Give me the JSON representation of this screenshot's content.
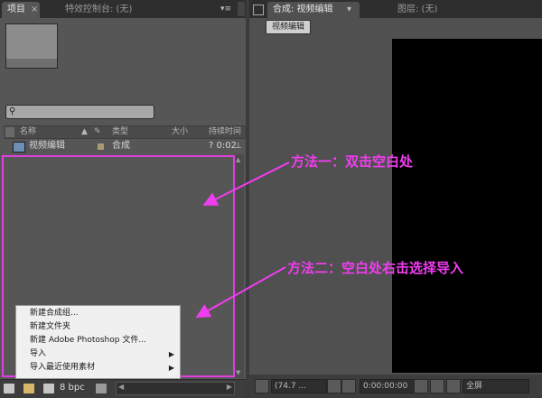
{
  "left_panel": {
    "tabs": [
      {
        "label": "项目",
        "close": "×"
      },
      {
        "label": "特效控制台: (无)"
      }
    ],
    "panel_menu_icon": "panel-menu-icon",
    "columns": {
      "name": "名称",
      "type": "类型",
      "size": "大小",
      "duration": "持续时间"
    },
    "items": [
      {
        "name": "视频编辑",
        "type": "合成",
        "duration": "? 0:02"
      }
    ],
    "bottom": {
      "bpc": "8 bpc"
    },
    "context_menu": [
      {
        "label": "新建合成组...",
        "submenu": false
      },
      {
        "label": "新建文件夹",
        "submenu": false
      },
      {
        "label": "新建 Adobe Photoshop 文件...",
        "submenu": false
      },
      {
        "label": "导入",
        "submenu": true
      },
      {
        "label": "导入最近使用素材",
        "submenu": true
      }
    ]
  },
  "right_panel": {
    "tabs": [
      {
        "label": "合成: 视频编辑"
      },
      {
        "label": "图层: (无)"
      }
    ],
    "comp_pill": "视频编辑",
    "bottom": {
      "zoom": "(74.7 ...",
      "timecode": "0:00:00:00",
      "resolution": "全屏"
    }
  },
  "annotations": {
    "method1": "方法一：双击空白处",
    "method2": "方法二：空白处右击选择导入"
  },
  "colors": {
    "annotation": "#f13df0"
  }
}
